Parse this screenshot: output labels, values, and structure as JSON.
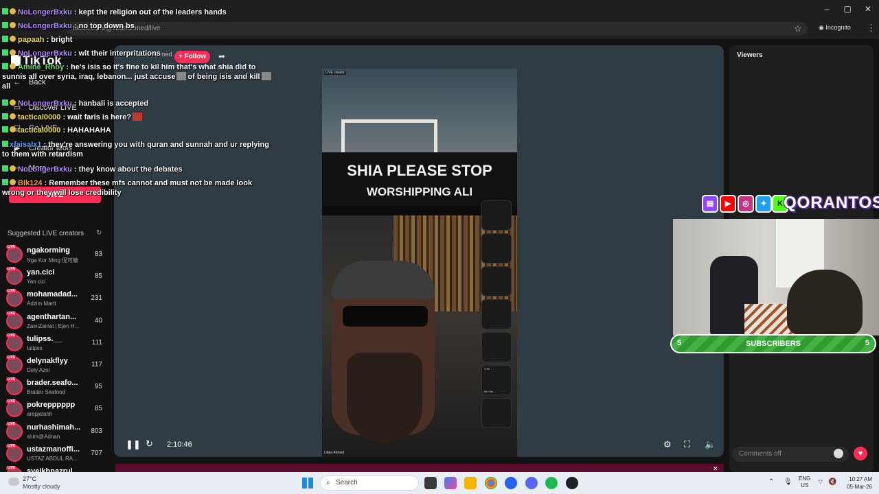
{
  "browser": {
    "url": "tiktok.com/@libanahmed/live",
    "incognito_label": "Incognito",
    "window_controls": [
      "minimize-icon",
      "restore-icon",
      "close-icon"
    ]
  },
  "sidebar": {
    "logo": "TikTok",
    "nav": [
      {
        "label": "Back",
        "icon": "back-arrow-icon"
      },
      {
        "label": "Discover LIVE",
        "icon": "discover-icon"
      },
      {
        "label": "Go LIVE",
        "icon": "golive-icon"
      },
      {
        "label": "Creator tools",
        "icon": "creator-tools-icon"
      },
      {
        "label": "More",
        "icon": "more-icon"
      }
    ],
    "live_button": "LIVE",
    "suggested_title": "Suggested LIVE creators",
    "creators": [
      {
        "name": "ngakorming",
        "sub": "Nga Kor Ming 倪可敏",
        "count": "83"
      },
      {
        "name": "yan.cici",
        "sub": "Yan cici",
        "count": "85"
      },
      {
        "name": "mohamadad...",
        "sub": "Adzim Martt",
        "count": "231"
      },
      {
        "name": "agenthartan...",
        "sub": "ZainiZainal | Ejen H...",
        "count": "40"
      },
      {
        "name": "tulipss.__",
        "sub": "tulipss",
        "count": "111"
      },
      {
        "name": "delynakflyy",
        "sub": "Dely Azni",
        "count": "117"
      },
      {
        "name": "brader.seafo...",
        "sub": "Brader Seafood",
        "count": "95"
      },
      {
        "name": "pokrepppppp",
        "sub": "arepjelahh",
        "count": "85"
      },
      {
        "name": "nurhashimah...",
        "sub": "shim@Adnan",
        "count": "803"
      },
      {
        "name": "ustazmanoffi...",
        "sub": "USTAZ ABDUL RA...",
        "count": "707"
      },
      {
        "name": "syeikhnazrul",
        "sub": "",
        "count": ""
      }
    ]
  },
  "stream": {
    "host": "Liban Ahmed",
    "follow_label": "+ Follow",
    "live_tag": "LIVE creator",
    "banner_line1": "SHIA PLEASE STOP",
    "banner_line2": "WORSHIPPING ALI",
    "credit": "Liban Ahmed",
    "guest_label": "Ibn Om...",
    "guest_count": "1.2K",
    "elapsed": "2:10:46"
  },
  "viewers_panel": {
    "title": "Viewers",
    "comments_placeholder": "Comments off"
  },
  "overlay": {
    "brand": "QORANTOS",
    "social_icons": [
      "twitch-icon",
      "youtube-icon",
      "instagram-icon",
      "twitter-icon",
      "kick-icon"
    ],
    "subscribers_label": "SUBSCRIBERS",
    "sub_left": "5",
    "sub_right": "5"
  },
  "chat": [
    {
      "user": "NoLongerBxku",
      "text": "kept the religion out of the leaders hands",
      "color": "purple"
    },
    {
      "user": "NoLongerBxku",
      "text": "no top down bs",
      "color": "purple"
    },
    {
      "user": "papaah",
      "text": "bright",
      "color": "yellow"
    },
    {
      "user": "NoLongerBxku",
      "text": "wit their interpritations",
      "color": "purple"
    },
    {
      "user": "Amine_Rhoy",
      "text": "he's isis so it's fine to kil him that's what shia did to sunnis all over syria, iraq, lebanon... just accuse",
      "text2": "of being isis and kill",
      "text3": "all",
      "color": "green"
    },
    {
      "user": "NoLongerBxku",
      "text": "hanbali is accepted",
      "color": "purple"
    },
    {
      "user": "tactical0000",
      "text": "wait faris is here?",
      "color": "yellow"
    },
    {
      "user": "tactical0000",
      "text": "HAHAHAHA",
      "color": "yellow"
    },
    {
      "user": "xfaisalx1",
      "text": "they're answering you with quran and sunnah and ur replying to them with retardism",
      "color": "blue"
    },
    {
      "user": "NoLongerBxku",
      "text": "they know about the debates",
      "color": "purple"
    },
    {
      "user": "Blk124",
      "text": "Remember these mfs cannot and must not be made look wrong or they will lose credibility",
      "color": "orange"
    }
  ],
  "taskbar": {
    "temp": "27°C",
    "condition": "Mostly cloudy",
    "search_placeholder": "Search",
    "lang_top": "ENG",
    "lang_bottom": "US",
    "time": "10:27 AM",
    "date": "05-Mar-26"
  },
  "colors": {
    "tiktok_pink": "#fe2c55",
    "panel_bg": "#2f3c44",
    "sub_green": "#3aa43a",
    "brand_purple": "#5b2ca0"
  }
}
